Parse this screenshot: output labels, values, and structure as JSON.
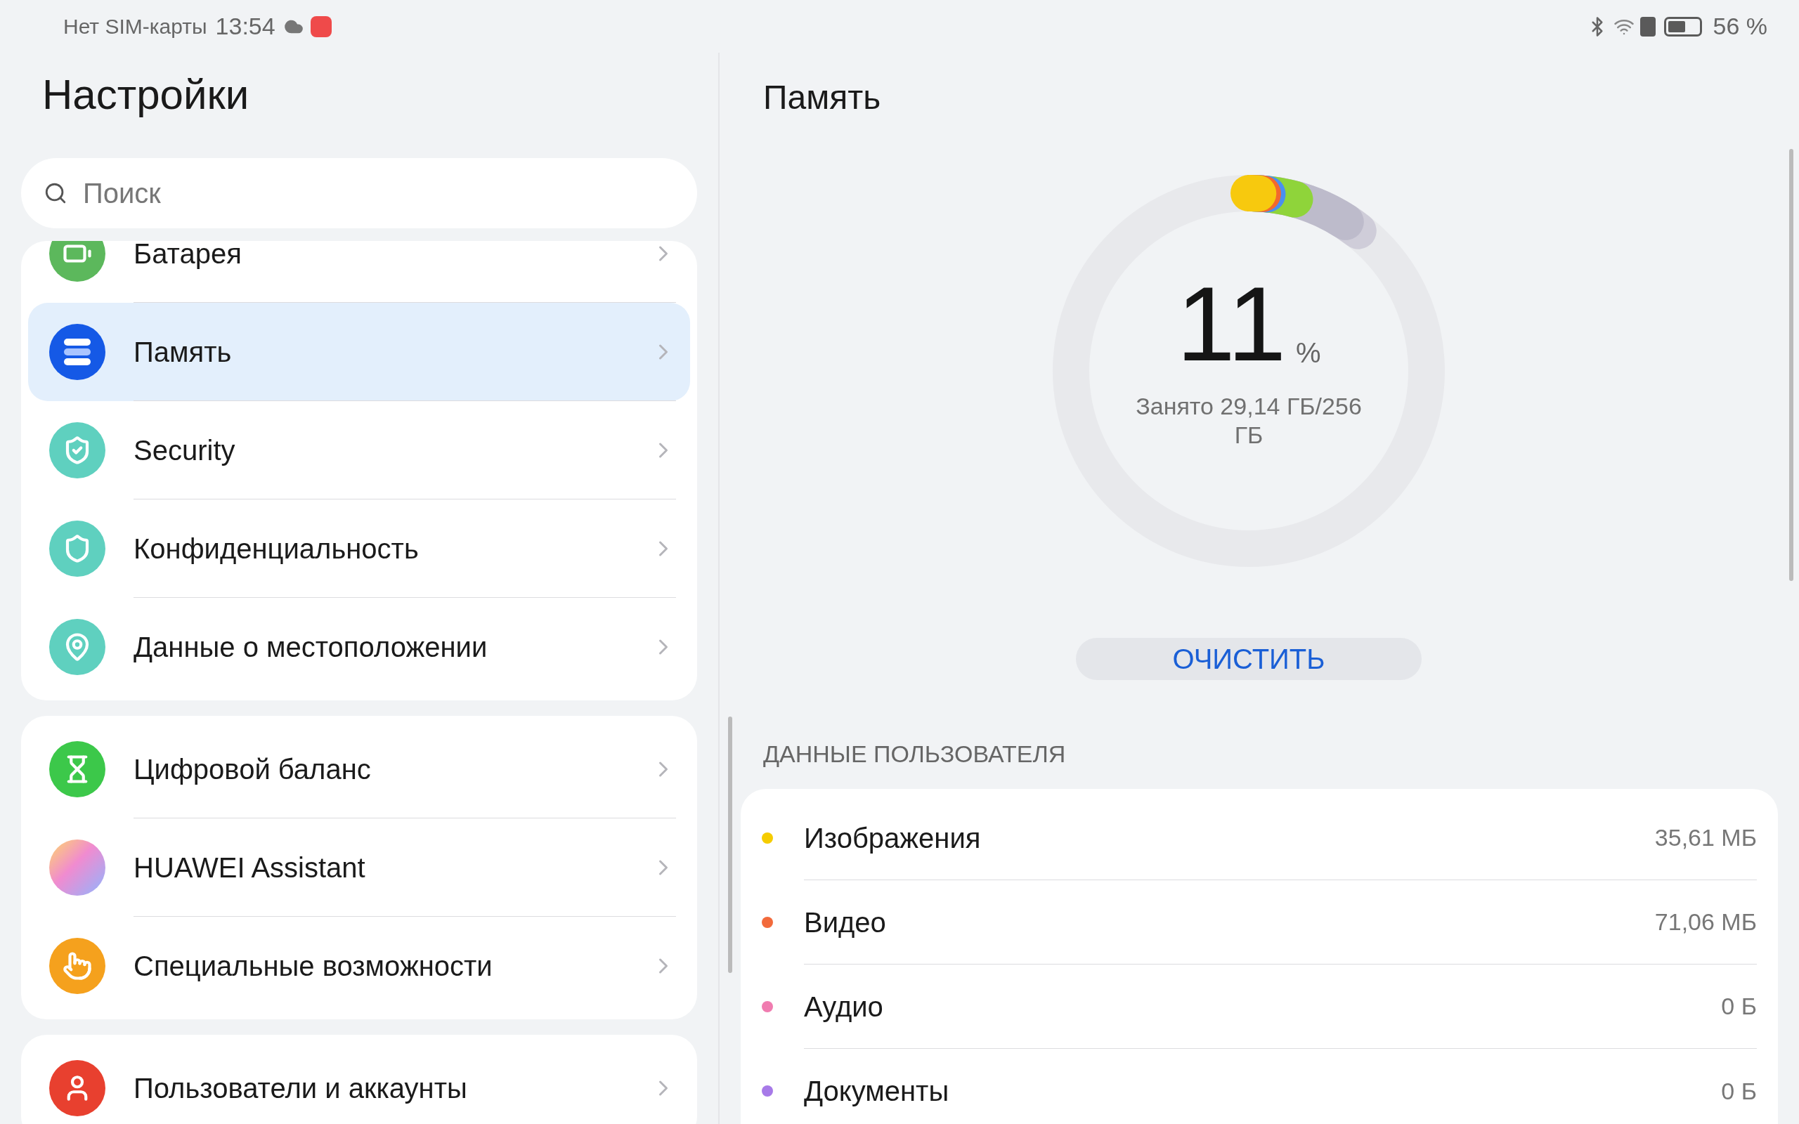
{
  "status_bar": {
    "carrier": "Нет SIM-карты",
    "time": "13:54",
    "battery": "56 %"
  },
  "sidebar": {
    "title": "Настройки",
    "search": {
      "placeholder": "Поиск"
    },
    "groups": [
      {
        "items": [
          {
            "label": "Батарея",
            "kind": "battery",
            "selected": false
          },
          {
            "label": "Память",
            "kind": "storage",
            "selected": true
          },
          {
            "label": "Security",
            "kind": "security",
            "selected": false
          },
          {
            "label": "Конфиденциальность",
            "kind": "privacy",
            "selected": false
          },
          {
            "label": "Данные о местоположении",
            "kind": "location",
            "selected": false
          }
        ]
      },
      {
        "items": [
          {
            "label": "Цифровой баланс",
            "kind": "balance",
            "selected": false
          },
          {
            "label": "HUAWEI Assistant",
            "kind": "assistant",
            "selected": false
          },
          {
            "label": "Специальные возможности",
            "kind": "accessibility",
            "selected": false
          }
        ]
      },
      {
        "items": [
          {
            "label": "Пользователи и аккаунты",
            "kind": "users",
            "selected": false
          }
        ]
      }
    ]
  },
  "storage": {
    "title": "Память",
    "percent": "11",
    "percent_sign": "%",
    "used": "Занято 29,14 ГБ/256 ГБ",
    "button": "ОЧИСТИТЬ",
    "section": "ДАННЫЕ ПОЛЬЗОВАТЕЛЯ",
    "items": [
      {
        "label": "Изображения",
        "size": "35,61 МБ",
        "color": "#f5cc00"
      },
      {
        "label": "Видео",
        "size": "71,06 МБ",
        "color": "#f26a3b"
      },
      {
        "label": "Аудио",
        "size": "0 Б",
        "color": "#f07cb0"
      },
      {
        "label": "Документы",
        "size": "0 Б",
        "color": "#a77ae8"
      }
    ]
  }
}
